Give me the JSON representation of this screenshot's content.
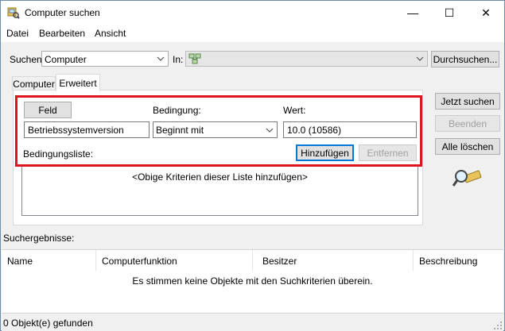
{
  "window": {
    "title": "Computer suchen",
    "minimize_glyph": "—",
    "maximize_glyph": "☐",
    "close_glyph": "✕"
  },
  "menu": {
    "items": [
      {
        "label": "Datei"
      },
      {
        "label": "Bearbeiten"
      },
      {
        "label": "Ansicht"
      }
    ]
  },
  "search_bar": {
    "suchen_label": "Suchen:",
    "suchen_value": "Computer",
    "in_label": "In:",
    "in_value": "",
    "browse_button": "Durchsuchen..."
  },
  "tabs": [
    {
      "label": "Computer",
      "active": false
    },
    {
      "label": "Erweitert",
      "active": true
    }
  ],
  "criteria": {
    "field_button": "Feld",
    "condition_label": "Bedingung:",
    "value_label": "Wert:",
    "field_value": "Betriebssystemversion",
    "condition_value": "Beginnt mit",
    "value_value": "10.0 (10586)",
    "condition_list_label": "Bedingungsliste:",
    "add_button": "Hinzufügen",
    "remove_button": "Entfernen",
    "list_placeholder": "<Obige Kriterien dieser Liste hinzufügen>"
  },
  "actions": {
    "search_now": "Jetzt suchen",
    "stop": "Beenden",
    "clear_all": "Alle löschen"
  },
  "results": {
    "label": "Suchergebnisse:",
    "columns": [
      "Name",
      "Computerfunktion",
      "Besitzer",
      "Beschreibung"
    ],
    "empty_message": "Es stimmen keine Objekte mit den Suchkriterien überein."
  },
  "status": {
    "text": "0 Objekt(e) gefunden"
  },
  "colors": {
    "highlight": "#e0141e",
    "accent": "#0078d7"
  },
  "icons": {
    "title": "find-computer-icon",
    "search_graphic": "magnifier-icon"
  }
}
